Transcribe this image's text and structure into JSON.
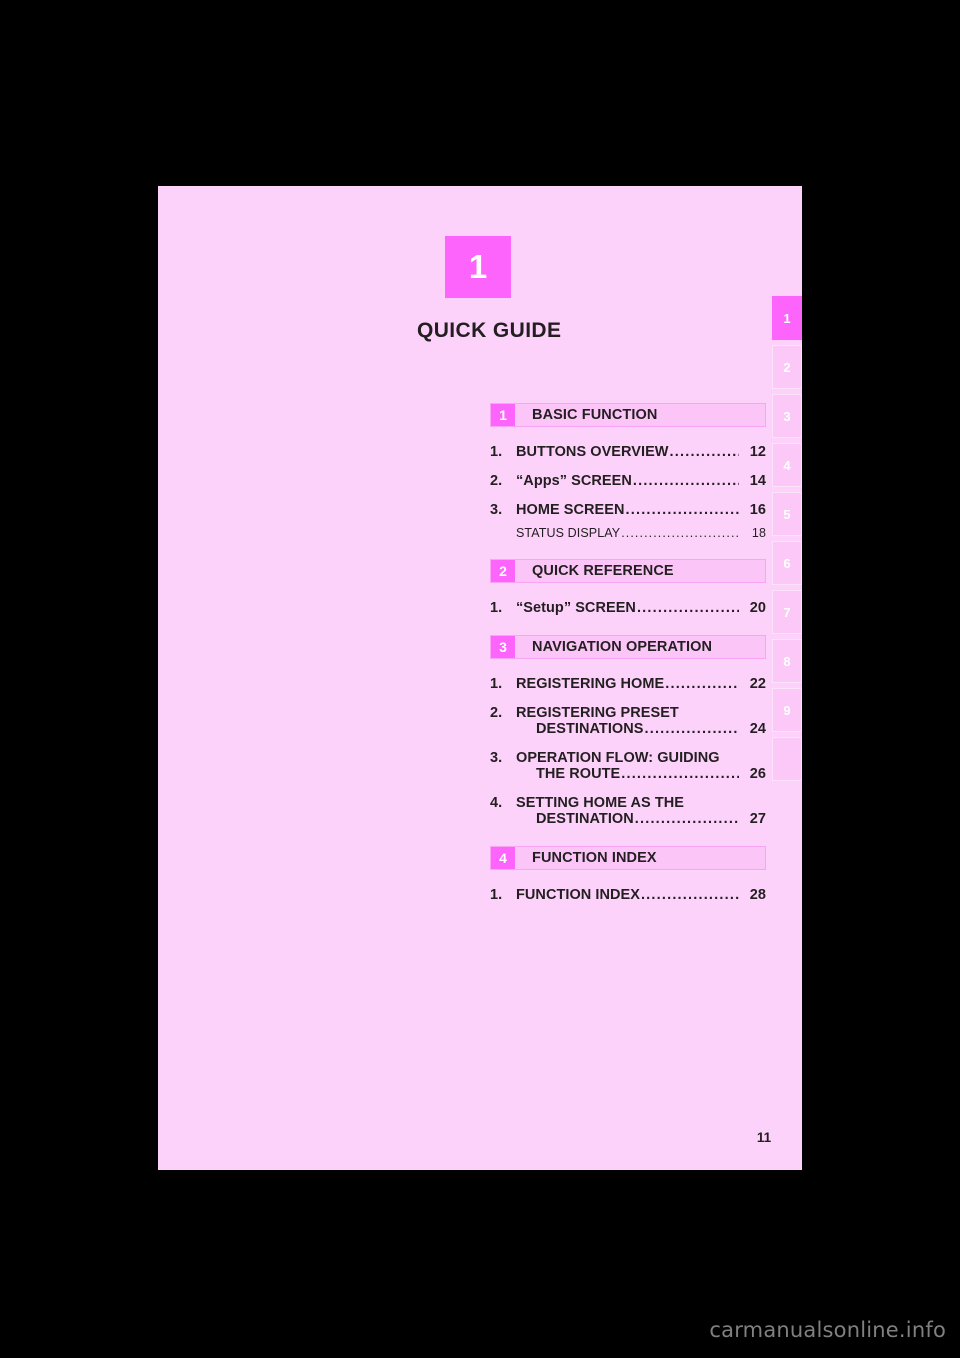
{
  "document": {
    "chapter_number": "1",
    "chapter_title": "QUICK GUIDE",
    "page_number": "11",
    "watermark": "carmanualsonline.info"
  },
  "colors": {
    "page_background": "#fcd2fa",
    "accent_magenta": "#fc64fc",
    "section_bar_fill": "#fbc5f8",
    "section_bar_border": "#f9a3f4",
    "text": "#231f20",
    "tab_inactive": "#fbc8f8",
    "tab_border": "#fde2fb",
    "watermark": "#808080",
    "canvas": "#000000"
  },
  "toc": {
    "sections": [
      {
        "number": "1",
        "label": "BASIC FUNCTION",
        "entries": [
          {
            "number": "1.",
            "lines": [
              {
                "text": "BUTTONS OVERVIEW",
                "leader": true,
                "page": "12"
              }
            ]
          },
          {
            "number": "2.",
            "lines": [
              {
                "text": "“Apps” SCREEN",
                "leader": true,
                "page": "14"
              }
            ]
          },
          {
            "number": "3.",
            "lines": [
              {
                "text": "HOME SCREEN",
                "leader": true,
                "page": "16"
              }
            ],
            "sub": [
              {
                "text": "STATUS DISPLAY",
                "leader": true,
                "page": "18"
              }
            ]
          }
        ]
      },
      {
        "number": "2",
        "label": "QUICK REFERENCE",
        "entries": [
          {
            "number": "1.",
            "lines": [
              {
                "text": "“Setup” SCREEN",
                "leader": true,
                "page": "20"
              }
            ]
          }
        ]
      },
      {
        "number": "3",
        "label": "NAVIGATION OPERATION",
        "entries": [
          {
            "number": "1.",
            "lines": [
              {
                "text": "REGISTERING HOME",
                "leader": true,
                "page": "22"
              }
            ]
          },
          {
            "number": "2.",
            "lines": [
              {
                "text": "REGISTERING PRESET",
                "leader": false,
                "page": ""
              },
              {
                "text": "DESTINATIONS",
                "leader": true,
                "page": "24",
                "wrap": true
              }
            ]
          },
          {
            "number": "3.",
            "lines": [
              {
                "text": "OPERATION FLOW: GUIDING",
                "leader": false,
                "page": ""
              },
              {
                "text": "THE ROUTE",
                "leader": true,
                "page": "26",
                "wrap": true
              }
            ]
          },
          {
            "number": "4.",
            "lines": [
              {
                "text": "SETTING HOME AS THE",
                "leader": false,
                "page": ""
              },
              {
                "text": "DESTINATION",
                "leader": true,
                "page": "27",
                "wrap": true
              }
            ]
          }
        ]
      },
      {
        "number": "4",
        "label": "FUNCTION INDEX",
        "entries": [
          {
            "number": "1.",
            "lines": [
              {
                "text": "FUNCTION INDEX",
                "leader": true,
                "page": "28"
              }
            ]
          }
        ]
      }
    ]
  },
  "tab_strip": {
    "active_index": 0,
    "tabs": [
      {
        "label": "1"
      },
      {
        "label": "2"
      },
      {
        "label": "3"
      },
      {
        "label": "4"
      },
      {
        "label": "5"
      },
      {
        "label": "6"
      },
      {
        "label": "7"
      },
      {
        "label": "8"
      },
      {
        "label": "9"
      },
      {
        "label": ""
      }
    ]
  }
}
